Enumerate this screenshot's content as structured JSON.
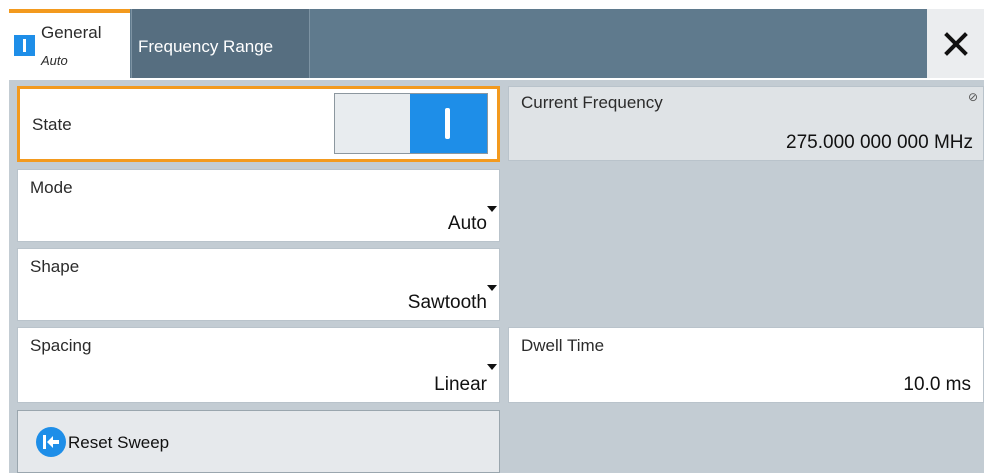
{
  "tabs": [
    {
      "label": "General",
      "sublabel": "Auto"
    },
    {
      "label": "Frequency Range"
    }
  ],
  "state": {
    "label": "State",
    "on": true
  },
  "current_frequency": {
    "label": "Current Frequency",
    "value": "275.000 000 000 MHz"
  },
  "mode": {
    "label": "Mode",
    "value": "Auto"
  },
  "shape": {
    "label": "Shape",
    "value": "Sawtooth"
  },
  "spacing": {
    "label": "Spacing",
    "value": "Linear"
  },
  "dwell_time": {
    "label": "Dwell Time",
    "value": "10.0 ms"
  },
  "reset": {
    "label": "Reset Sweep"
  },
  "icons": {
    "close": "close-icon",
    "reset": "reset-arrow-icon",
    "readonly": "readonly-icon"
  },
  "colors": {
    "accent": "#f39a1e",
    "toggle_on": "#1e8ee8",
    "header": "#5f7a8d",
    "panel": "#c3ccd3"
  }
}
